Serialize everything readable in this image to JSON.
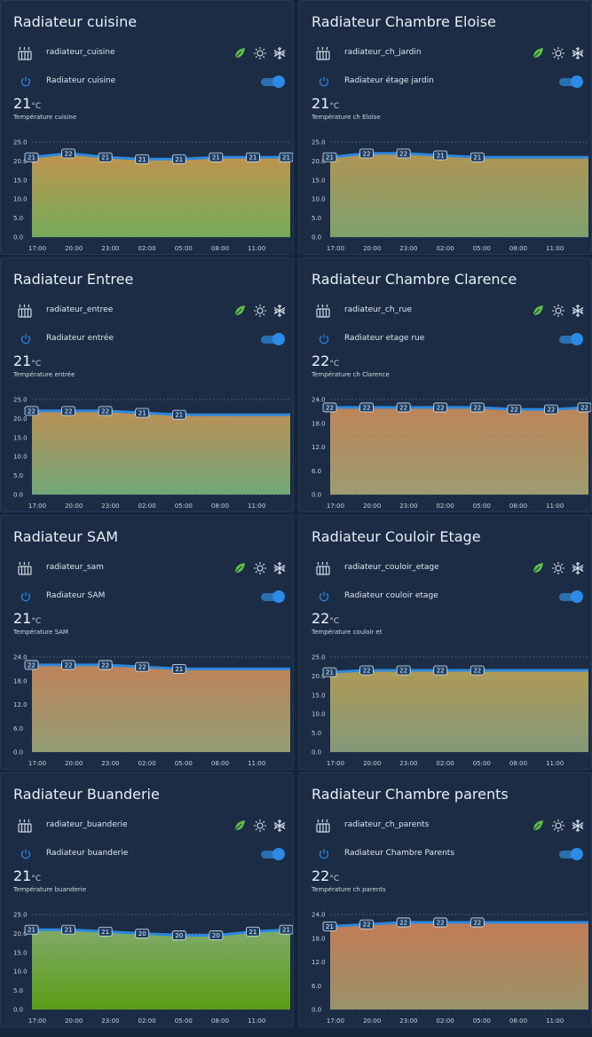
{
  "cards": [
    {
      "title": "Radiateur cuisine",
      "entity": "radiateur_cuisine",
      "switch_label": "Radiateur cuisine",
      "temperature": "21",
      "unit": "°C",
      "sensor_label": "Température cuisine",
      "icons": [
        "heater-icon",
        "leaf-icon",
        "sun-icon",
        "snowflake-icon",
        "power-icon"
      ],
      "switch_on": true,
      "chart_data": {
        "type": "area",
        "x": [
          "17:00",
          "20:00",
          "23:00",
          "02:00",
          "05:00",
          "08:00",
          "11:00"
        ],
        "y_ticks": [
          "25.0",
          "20.0",
          "15.0",
          "10.0",
          "5.0",
          "0.0"
        ],
        "ylim": [
          0,
          25
        ],
        "series": [
          {
            "values": [
              21,
              22,
              21,
              20.5,
              20.5,
              21,
              21,
              21
            ]
          }
        ],
        "point_labels": [
          "21",
          "22",
          "21",
          "21",
          "21",
          "21",
          "21",
          "21"
        ],
        "fill_top": "#c8984f",
        "fill_bottom": "#7ab35a",
        "line_color": "#2d88dd"
      }
    },
    {
      "title": "Radiateur Chambre Eloise",
      "entity": "radiateur_ch_jardin",
      "switch_label": "Radiateur étage jardin",
      "temperature": "21",
      "unit": "°C",
      "sensor_label": "Température ch Eloïse",
      "icons": [
        "heater-icon",
        "leaf-icon",
        "sun-icon",
        "snowflake-icon",
        "power-icon"
      ],
      "switch_on": true,
      "chart_data": {
        "type": "area",
        "x": [
          "17:00",
          "20:00",
          "23:00",
          "02:00",
          "05:00",
          "08:00",
          "11:00"
        ],
        "y_ticks": [
          "25.0",
          "20.0",
          "15.0",
          "10.0",
          "5.0",
          "0.0"
        ],
        "ylim": [
          0,
          25
        ],
        "series": [
          {
            "values": [
              21,
              22,
              22,
              21.5,
              21,
              21,
              21,
              21
            ]
          }
        ],
        "point_labels": [
          "21",
          "22",
          "22",
          "21",
          "21"
        ],
        "fill_top": "#b79a55",
        "fill_bottom": "#82a870",
        "line_color": "#2d88dd"
      }
    },
    {
      "title": "Radiateur Entree",
      "entity": "radiateur_entree",
      "switch_label": "Radiateur entrée",
      "temperature": "21",
      "unit": "°C",
      "sensor_label": "Température entrée",
      "icons": [
        "heater-icon",
        "leaf-icon",
        "sun-icon",
        "snowflake-icon",
        "power-icon"
      ],
      "switch_on": true,
      "chart_data": {
        "type": "area",
        "x": [
          "17:00",
          "20:00",
          "23:00",
          "02:00",
          "05:00",
          "08:00",
          "11:00"
        ],
        "y_ticks": [
          "25.0",
          "20.0",
          "15.0",
          "10.0",
          "5.0",
          "0.0"
        ],
        "ylim": [
          0,
          25
        ],
        "series": [
          {
            "values": [
              22,
              22,
              22,
              21.5,
              21,
              21,
              21,
              21
            ]
          }
        ],
        "point_labels": [
          "22",
          "22",
          "22",
          "21",
          "21"
        ],
        "fill_top": "#c29556",
        "fill_bottom": "#77ae7c",
        "line_color": "#2d88dd"
      }
    },
    {
      "title": "Radiateur Chambre Clarence",
      "entity": "radiateur_ch_rue",
      "switch_label": "Radiateur etage rue",
      "temperature": "22",
      "unit": "°C",
      "sensor_label": "Température ch Clarence",
      "icons": [
        "heater-icon",
        "leaf-icon",
        "sun-icon",
        "snowflake-icon",
        "power-icon"
      ],
      "switch_on": true,
      "chart_data": {
        "type": "area",
        "x": [
          "17:00",
          "20:00",
          "23:00",
          "02:00",
          "05:00",
          "08:00",
          "11:00"
        ],
        "y_ticks": [
          "24.0",
          "18.0",
          "12.0",
          "6.0",
          "0.0"
        ],
        "ylim": [
          0,
          24
        ],
        "series": [
          {
            "values": [
              22,
              22,
              22,
              22,
              22,
              21.5,
              21.5,
              22
            ]
          }
        ],
        "point_labels": [
          "22",
          "22",
          "22",
          "22",
          "22",
          "22",
          "22",
          "22"
        ],
        "fill_top": "#c58a5a",
        "fill_bottom": "#a4a173",
        "line_color": "#2d88dd"
      }
    },
    {
      "title": "Radiateur SAM",
      "entity": "radiateur_sam",
      "switch_label": "Radiateur SAM",
      "temperature": "21",
      "unit": "°C",
      "sensor_label": "Température SAM",
      "icons": [
        "heater-icon",
        "leaf-icon",
        "sun-icon",
        "snowflake-icon",
        "power-icon"
      ],
      "switch_on": true,
      "chart_data": {
        "type": "area",
        "x": [
          "17:00",
          "20:00",
          "23:00",
          "02:00",
          "05:00",
          "08:00",
          "11:00"
        ],
        "y_ticks": [
          "24.0",
          "18.0",
          "12.0",
          "6.0",
          "0.0"
        ],
        "ylim": [
          0,
          24
        ],
        "series": [
          {
            "values": [
              22,
              22,
              22,
              21.5,
              21,
              21,
              21,
              21
            ]
          }
        ],
        "point_labels": [
          "22",
          "22",
          "22",
          "22",
          "21"
        ],
        "fill_top": "#c7875a",
        "fill_bottom": "#9aa478",
        "line_color": "#2d88dd"
      }
    },
    {
      "title": "Radiateur Couloir Etage",
      "entity": "radiateur_couloir_etage",
      "switch_label": "Radiateur couloir etage",
      "temperature": "22",
      "unit": "°C",
      "sensor_label": "Température couloir et",
      "icons": [
        "heater-icon",
        "leaf-icon",
        "sun-icon",
        "snowflake-icon",
        "power-icon"
      ],
      "switch_on": true,
      "chart_data": {
        "type": "area",
        "x": [
          "17:00",
          "20:00",
          "23:00",
          "02:00",
          "05:00",
          "08:00",
          "11:00"
        ],
        "y_ticks": [
          "25.0",
          "20.0",
          "15.0",
          "10.0",
          "5.0",
          "0.0"
        ],
        "ylim": [
          0,
          25
        ],
        "series": [
          {
            "values": [
              21,
              21.5,
              21.5,
              21.5,
              21.5,
              21.5,
              21.5,
              21.5
            ]
          }
        ],
        "point_labels": [
          "21",
          "22",
          "22",
          "22",
          "22"
        ],
        "fill_top": "#b5a057",
        "fill_bottom": "#899f7b",
        "line_color": "#2d88dd"
      }
    },
    {
      "title": "Radiateur Buanderie",
      "entity": "radiateur_buanderie",
      "switch_label": "Radiateur buanderie",
      "temperature": "21",
      "unit": "°C",
      "sensor_label": "Température buanderie",
      "icons": [
        "heater-icon",
        "leaf-icon",
        "sun-icon",
        "snowflake-icon",
        "power-icon"
      ],
      "switch_on": true,
      "chart_data": {
        "type": "area",
        "x": [
          "17:00",
          "20:00",
          "23:00",
          "02:00",
          "05:00",
          "08:00",
          "11:00"
        ],
        "y_ticks": [
          "25.0",
          "20.0",
          "15.0",
          "10.0",
          "5.0",
          "0.0"
        ],
        "ylim": [
          0,
          25
        ],
        "series": [
          {
            "values": [
              21,
              21,
              20.5,
              20,
              19.5,
              19.5,
              20.5,
              21
            ]
          }
        ],
        "point_labels": [
          "21",
          "21",
          "21",
          "20",
          "20",
          "20",
          "21",
          "21"
        ],
        "fill_top": "#84b06a",
        "fill_bottom": "#5fa413",
        "line_color": "#2d88dd"
      }
    },
    {
      "title": "Radiateur Chambre parents",
      "entity": "radiateur_ch_parents",
      "switch_label": "Radiateur Chambre Parents",
      "temperature": "22",
      "unit": "°C",
      "sensor_label": "Température ch parents",
      "icons": [
        "heater-icon",
        "leaf-icon",
        "sun-icon",
        "snowflake-icon",
        "power-icon"
      ],
      "switch_on": true,
      "chart_data": {
        "type": "area",
        "x": [
          "17:00",
          "20:00",
          "23:00",
          "02:00",
          "05:00",
          "08:00",
          "11:00"
        ],
        "y_ticks": [
          "24.0",
          "18.0",
          "12.0",
          "6.0",
          "0.0"
        ],
        "ylim": [
          0,
          24
        ],
        "series": [
          {
            "values": [
              21,
              21.5,
              22,
              22,
              22,
              22,
              22,
              22
            ]
          }
        ],
        "point_labels": [
          "21",
          "22",
          "22",
          "22",
          "22"
        ],
        "fill_top": "#cb8157",
        "fill_bottom": "#a0986c",
        "line_color": "#2d88dd"
      }
    }
  ]
}
